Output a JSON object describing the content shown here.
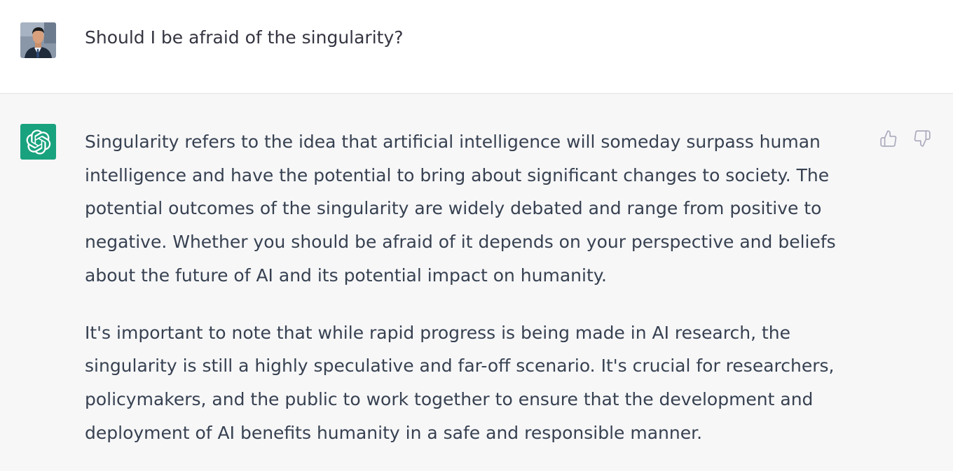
{
  "conversation": {
    "user": {
      "message": "Should I be afraid of the singularity?"
    },
    "assistant": {
      "avatar_icon": "openai-logo-icon",
      "avatar_color": "#19a27e",
      "paragraphs": [
        "Singularity refers to the idea that artificial intelligence will someday surpass human intelligence and have the potential to bring about significant changes to society. The potential outcomes of the singularity are widely debated and range from positive to negative. Whether you should be afraid of it depends on your perspective and beliefs about the future of AI and its potential impact on humanity.",
        "It's important to note that while rapid progress is being made in AI research, the singularity is still a highly speculative and far-off scenario. It's crucial for researchers, policymakers, and the public to work together to ensure that the development and deployment of AI benefits humanity in a safe and responsible manner."
      ],
      "feedback_icons": [
        "thumbs-up-icon",
        "thumbs-down-icon"
      ]
    }
  },
  "colors": {
    "user_bg": "#ffffff",
    "assistant_bg": "#f7f7f8",
    "text": "#374151",
    "icon": "#acacbe"
  }
}
